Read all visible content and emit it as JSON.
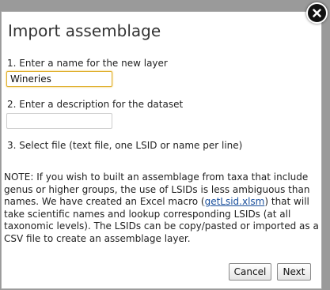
{
  "dialog": {
    "title": "Import assemblage",
    "step1_label": "1. Enter a name for the new layer",
    "layer_name_value": "Wineries",
    "step2_label": "2. Enter a description for the dataset",
    "description_value": "",
    "step3_label": "3. Select file (text file, one LSID or name per line)",
    "note_before_link": "NOTE: If you wish to built an assemblage from taxa that include genus or higher groups, the use of LSIDs is less ambiguous than names. We have created an Excel macro (",
    "note_link": "getLsid.xlsm",
    "note_after_link": ") that will take scientific names and lookup corresponding LSIDs (at all taxonomic levels). The LSIDs can be copy/pasted or imported as a CSV file to create an assemblage layer.",
    "cancel_label": "Cancel",
    "next_label": "Next",
    "close_icon": "close-icon"
  },
  "colors": {
    "link": "#1a4f9c",
    "focus_border": "#e0b030",
    "close_bg": "#111111"
  }
}
